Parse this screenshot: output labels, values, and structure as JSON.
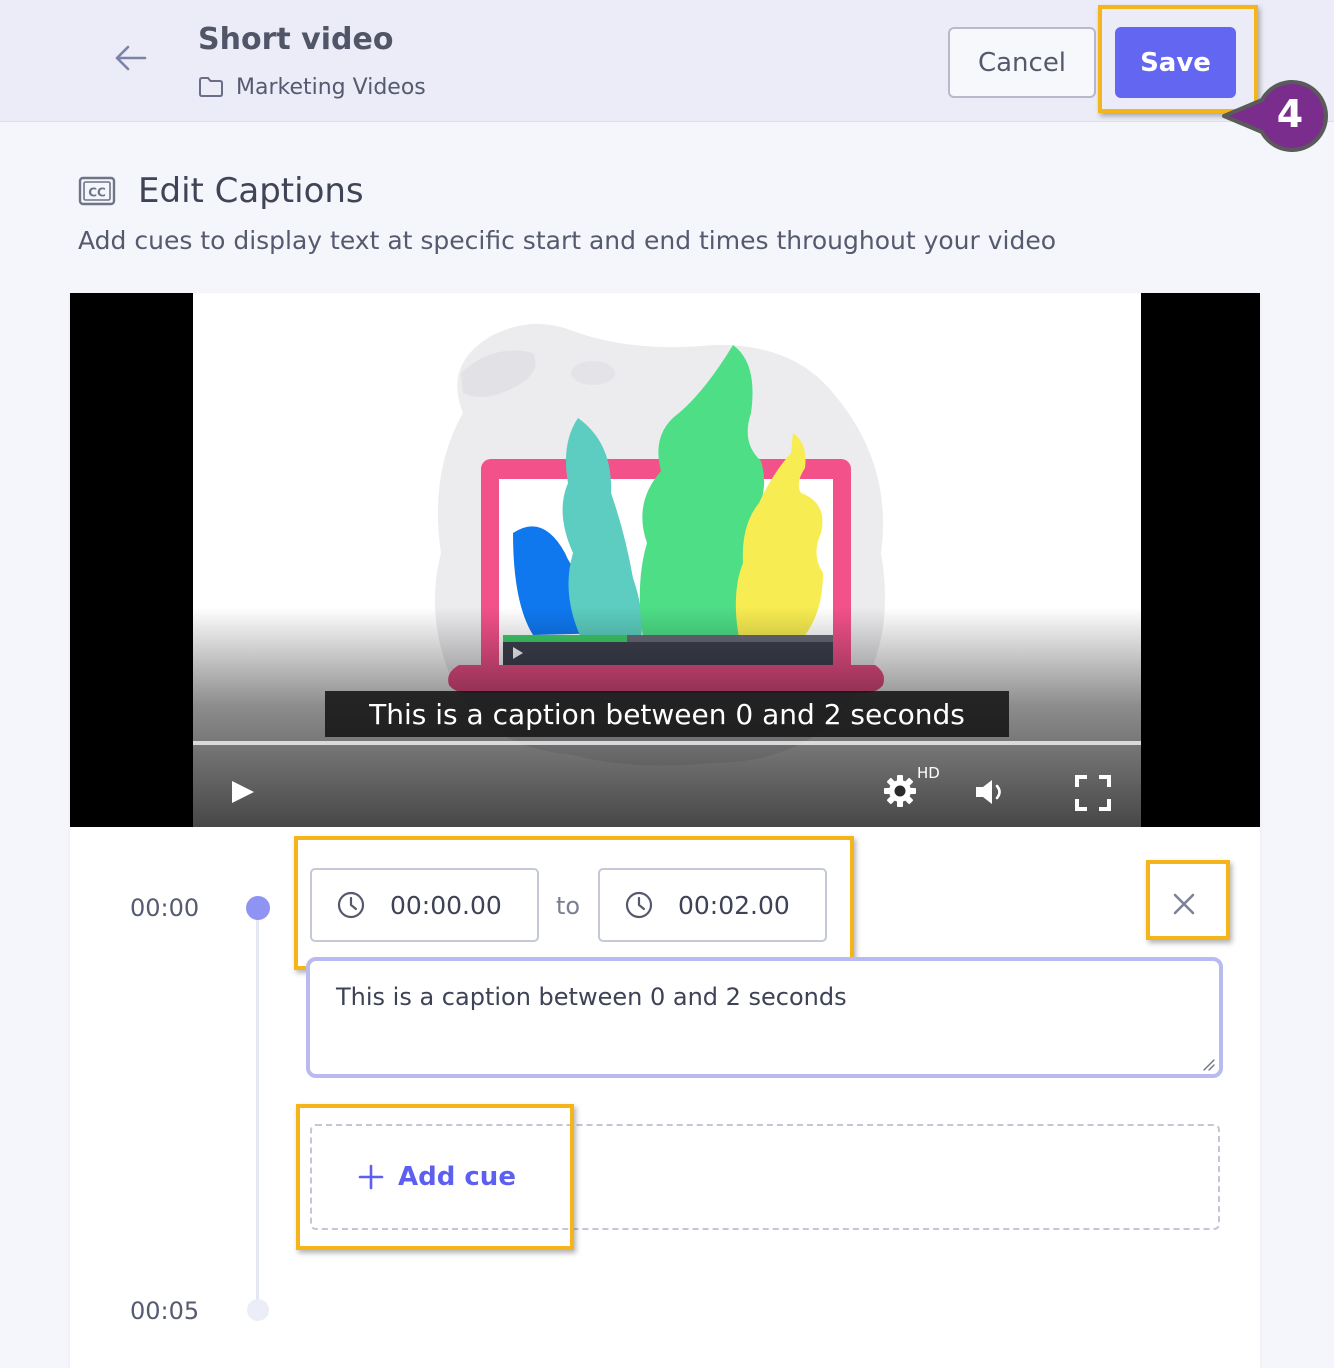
{
  "header": {
    "title": "Short video",
    "folder": "Marketing Videos",
    "cancel_label": "Cancel",
    "save_label": "Save",
    "step_number": "4"
  },
  "section": {
    "title": "Edit Captions",
    "description": "Add cues to display text at specific start and end times throughout your video"
  },
  "video": {
    "caption_overlay": "This is a caption between 0 and 2 seconds",
    "quality_badge": "HD",
    "progress_fraction": 0
  },
  "timeline": {
    "marks": [
      {
        "label": "00:00"
      },
      {
        "label": "00:05"
      }
    ]
  },
  "cue": {
    "start_time": "00:00.00",
    "separator": "to",
    "end_time": "00:02.00",
    "text": "This is a caption between 0 and 2 seconds"
  },
  "add_cue_label": "Add cue",
  "icons": {
    "back": "arrow-left-icon",
    "folder": "folder-icon",
    "captions": "closed-captions-icon",
    "play": "play-icon",
    "settings": "gear-icon",
    "volume": "volume-icon",
    "fullscreen": "fullscreen-icon",
    "clock": "clock-icon",
    "close": "close-icon",
    "add": "plus-icon"
  },
  "colors": {
    "accent": "#6366f1",
    "highlight": "#f5b51a",
    "step_badge": "#7b2d8e",
    "header_bg": "#ebecf7",
    "page_bg": "#f5f6fb"
  }
}
